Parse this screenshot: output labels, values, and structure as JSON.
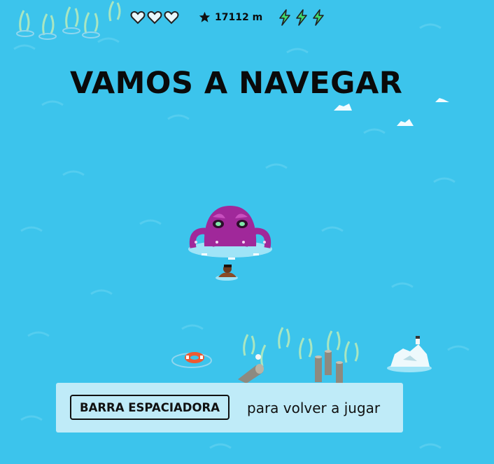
{
  "hud": {
    "lives": {
      "total": 3,
      "remaining": 0,
      "icon": "heart-icon"
    },
    "distance": {
      "icon": "star-icon",
      "value": "17112 m"
    },
    "boosts": {
      "total": 3,
      "remaining": 3,
      "icon": "lightning-bolt-icon"
    }
  },
  "title": "VAMOS A NAVEGAR",
  "prompt": {
    "key_label": "BARRA ESPACIADORA",
    "text": "para volver a jugar"
  },
  "colors": {
    "water": "#3cc4ec",
    "kraken": "#a0289a",
    "bolt": "#3fdc6e",
    "life_ring": "#ee5a32"
  }
}
